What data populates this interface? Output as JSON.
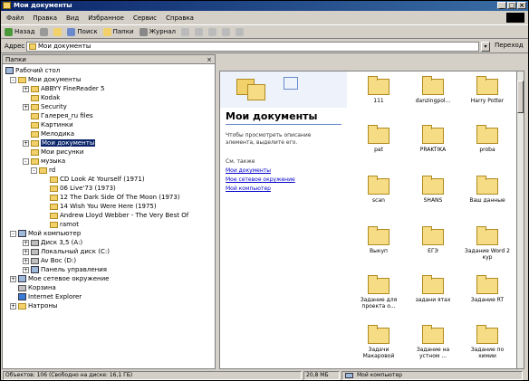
{
  "window": {
    "title": "Мои документы"
  },
  "menu": [
    "Файл",
    "Правка",
    "Вид",
    "Избранное",
    "Сервис",
    "Справка"
  ],
  "toolbar": [
    "Назад",
    "Вперед",
    "Вверх",
    "Поиск",
    "Папки",
    "Журнал"
  ],
  "address": {
    "label": "Адрес",
    "value": "Мои документы",
    "go_label": "Переход"
  },
  "folders_panel": {
    "title": "Папки",
    "close": "×"
  },
  "tree": [
    {
      "label": "Рабочий стол"
    },
    {
      "label": "Мои документы"
    },
    {
      "label": "ABBYY FineReader 5"
    },
    {
      "label": "Kodak"
    },
    {
      "label": "Security"
    },
    {
      "label": "Галерея_ru files"
    },
    {
      "label": "Картинки"
    },
    {
      "label": "Мелодика"
    },
    {
      "label": "Мои документы",
      "selected": true
    },
    {
      "label": "Мои рисунки"
    },
    {
      "label": "музыка"
    },
    {
      "label": "rd"
    },
    {
      "label": "CD Look At Yourself (1971)"
    },
    {
      "label": "06 Live'73 (1973)"
    },
    {
      "label": "12 The Dark Side Of The Moon (1973)"
    },
    {
      "label": "14 Wish You Were Here (1975)"
    },
    {
      "label": "Andrew Lloyd Webber - The Very Best Of"
    },
    {
      "label": "ramot"
    },
    {
      "label": "Мой компьютер"
    },
    {
      "label": "Диск 3,5 (A:)"
    },
    {
      "label": "Локальный диск (C:)"
    },
    {
      "label": "Av Вос (D:)"
    },
    {
      "label": "Панель управления"
    },
    {
      "label": "Мое сетевое окружение"
    },
    {
      "label": "Корзина"
    },
    {
      "label": "Internet Explorer"
    },
    {
      "label": "Натроны"
    }
  ],
  "web": {
    "title": "Мои документы",
    "text": "Чтобы просмотреть описание элемента, выделите его.",
    "see_also": "См. также",
    "links": [
      "Мои документы",
      "Мое сетевое окружение",
      "Мой компьютер"
    ]
  },
  "files": [
    "111",
    "danzingpol...",
    "Harry Potter",
    "pat",
    "PRAKTIKA",
    "proba",
    "scan",
    "SHANS",
    "Ваш данные",
    "Выкуп",
    "ЕГЭ",
    "Задание Word 2 кур",
    "Задание для проекта о...",
    "задани ятах",
    "Задание RT",
    "Задачи Макаровой",
    "Задание на устном ...",
    "Задание по химии"
  ],
  "status": {
    "left": "Объектов: 106 (Свободно на диске: 16,1 ГБ)",
    "size": "20,8 МБ",
    "zone": "Мой компьютер"
  }
}
